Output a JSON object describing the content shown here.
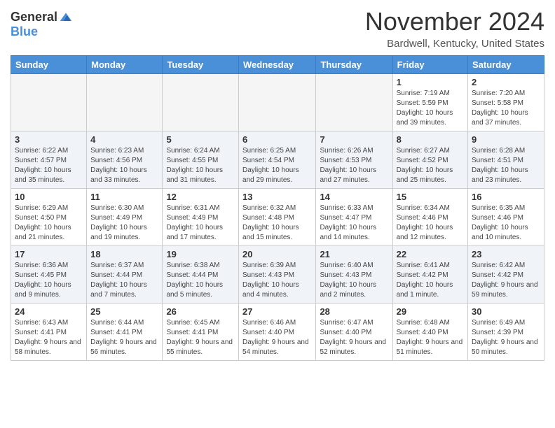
{
  "logo": {
    "general": "General",
    "blue": "Blue"
  },
  "header": {
    "month": "November 2024",
    "location": "Bardwell, Kentucky, United States"
  },
  "weekdays": [
    "Sunday",
    "Monday",
    "Tuesday",
    "Wednesday",
    "Thursday",
    "Friday",
    "Saturday"
  ],
  "weeks": [
    {
      "days": [
        {
          "num": "",
          "empty": true
        },
        {
          "num": "",
          "empty": true
        },
        {
          "num": "",
          "empty": true
        },
        {
          "num": "",
          "empty": true
        },
        {
          "num": "",
          "empty": true
        },
        {
          "num": "1",
          "info": "Sunrise: 7:19 AM\nSunset: 5:59 PM\nDaylight: 10 hours and 39 minutes."
        },
        {
          "num": "2",
          "info": "Sunrise: 7:20 AM\nSunset: 5:58 PM\nDaylight: 10 hours and 37 minutes."
        }
      ]
    },
    {
      "days": [
        {
          "num": "3",
          "info": "Sunrise: 6:22 AM\nSunset: 4:57 PM\nDaylight: 10 hours and 35 minutes."
        },
        {
          "num": "4",
          "info": "Sunrise: 6:23 AM\nSunset: 4:56 PM\nDaylight: 10 hours and 33 minutes."
        },
        {
          "num": "5",
          "info": "Sunrise: 6:24 AM\nSunset: 4:55 PM\nDaylight: 10 hours and 31 minutes."
        },
        {
          "num": "6",
          "info": "Sunrise: 6:25 AM\nSunset: 4:54 PM\nDaylight: 10 hours and 29 minutes."
        },
        {
          "num": "7",
          "info": "Sunrise: 6:26 AM\nSunset: 4:53 PM\nDaylight: 10 hours and 27 minutes."
        },
        {
          "num": "8",
          "info": "Sunrise: 6:27 AM\nSunset: 4:52 PM\nDaylight: 10 hours and 25 minutes."
        },
        {
          "num": "9",
          "info": "Sunrise: 6:28 AM\nSunset: 4:51 PM\nDaylight: 10 hours and 23 minutes."
        }
      ]
    },
    {
      "days": [
        {
          "num": "10",
          "info": "Sunrise: 6:29 AM\nSunset: 4:50 PM\nDaylight: 10 hours and 21 minutes."
        },
        {
          "num": "11",
          "info": "Sunrise: 6:30 AM\nSunset: 4:49 PM\nDaylight: 10 hours and 19 minutes."
        },
        {
          "num": "12",
          "info": "Sunrise: 6:31 AM\nSunset: 4:49 PM\nDaylight: 10 hours and 17 minutes."
        },
        {
          "num": "13",
          "info": "Sunrise: 6:32 AM\nSunset: 4:48 PM\nDaylight: 10 hours and 15 minutes."
        },
        {
          "num": "14",
          "info": "Sunrise: 6:33 AM\nSunset: 4:47 PM\nDaylight: 10 hours and 14 minutes."
        },
        {
          "num": "15",
          "info": "Sunrise: 6:34 AM\nSunset: 4:46 PM\nDaylight: 10 hours and 12 minutes."
        },
        {
          "num": "16",
          "info": "Sunrise: 6:35 AM\nSunset: 4:46 PM\nDaylight: 10 hours and 10 minutes."
        }
      ]
    },
    {
      "days": [
        {
          "num": "17",
          "info": "Sunrise: 6:36 AM\nSunset: 4:45 PM\nDaylight: 10 hours and 9 minutes."
        },
        {
          "num": "18",
          "info": "Sunrise: 6:37 AM\nSunset: 4:44 PM\nDaylight: 10 hours and 7 minutes."
        },
        {
          "num": "19",
          "info": "Sunrise: 6:38 AM\nSunset: 4:44 PM\nDaylight: 10 hours and 5 minutes."
        },
        {
          "num": "20",
          "info": "Sunrise: 6:39 AM\nSunset: 4:43 PM\nDaylight: 10 hours and 4 minutes."
        },
        {
          "num": "21",
          "info": "Sunrise: 6:40 AM\nSunset: 4:43 PM\nDaylight: 10 hours and 2 minutes."
        },
        {
          "num": "22",
          "info": "Sunrise: 6:41 AM\nSunset: 4:42 PM\nDaylight: 10 hours and 1 minute."
        },
        {
          "num": "23",
          "info": "Sunrise: 6:42 AM\nSunset: 4:42 PM\nDaylight: 9 hours and 59 minutes."
        }
      ]
    },
    {
      "days": [
        {
          "num": "24",
          "info": "Sunrise: 6:43 AM\nSunset: 4:41 PM\nDaylight: 9 hours and 58 minutes."
        },
        {
          "num": "25",
          "info": "Sunrise: 6:44 AM\nSunset: 4:41 PM\nDaylight: 9 hours and 56 minutes."
        },
        {
          "num": "26",
          "info": "Sunrise: 6:45 AM\nSunset: 4:41 PM\nDaylight: 9 hours and 55 minutes."
        },
        {
          "num": "27",
          "info": "Sunrise: 6:46 AM\nSunset: 4:40 PM\nDaylight: 9 hours and 54 minutes."
        },
        {
          "num": "28",
          "info": "Sunrise: 6:47 AM\nSunset: 4:40 PM\nDaylight: 9 hours and 52 minutes."
        },
        {
          "num": "29",
          "info": "Sunrise: 6:48 AM\nSunset: 4:40 PM\nDaylight: 9 hours and 51 minutes."
        },
        {
          "num": "30",
          "info": "Sunrise: 6:49 AM\nSunset: 4:39 PM\nDaylight: 9 hours and 50 minutes."
        }
      ]
    }
  ]
}
